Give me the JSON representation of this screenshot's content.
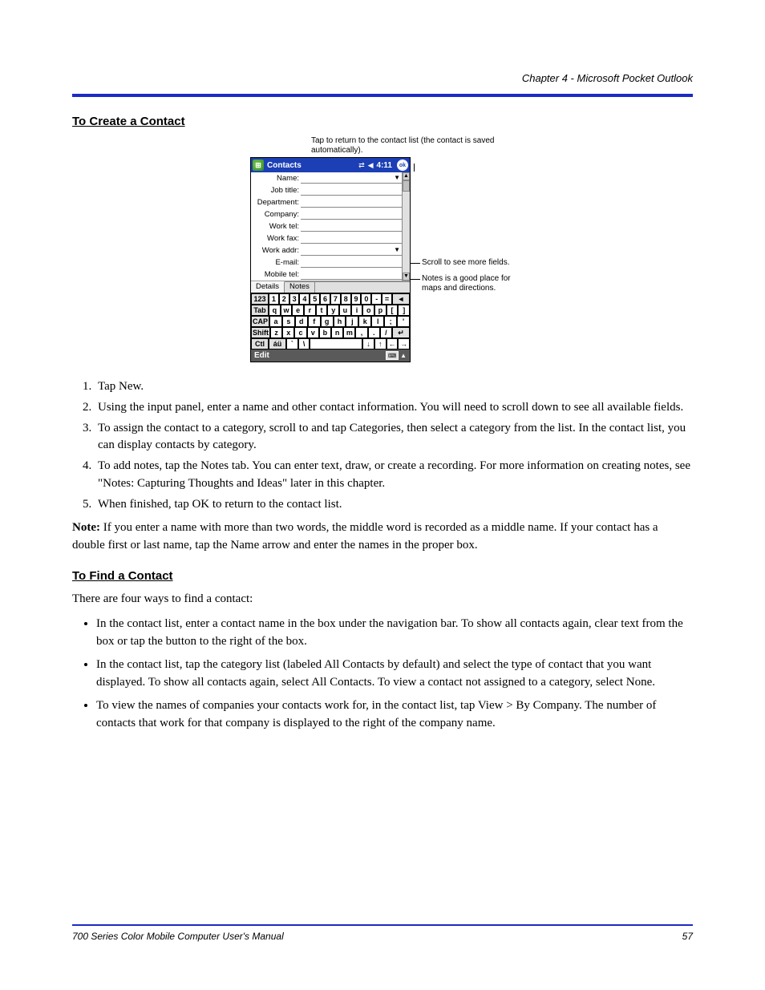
{
  "chapterLine": "Chapter 4 - Microsoft Pocket Outlook",
  "sections": {
    "create": {
      "heading": "To Create a Contact",
      "steps": [
        "Tap New.",
        "Using the input panel, enter a name and other contact information. You will need to scroll down to see all available fields.",
        "To assign the contact to a category, scroll to and tap Categories, then select a category from the list. In the contact list, you can display contacts by category.",
        "To add notes, tap the Notes tab. You can enter text, draw, or create a recording. For more information on creating notes, see \"Notes: Capturing Thoughts and Ideas\" later in this chapter.",
        "When finished, tap OK to return to the contact list."
      ],
      "noteLabel": "Note:",
      "noteText": " If you enter a name with more than two words, the middle word is recorded as a middle name. If your contact has a double first or last name, tap the Name arrow and enter the names in the proper box."
    },
    "find": {
      "heading": "To Find a Contact",
      "intro": "There are four ways to find a contact:",
      "bullets": [
        "In the contact list, enter a contact name in the box under the navigation bar. To show all contacts again, clear text from the box or tap the button to the right of the box.",
        "In the contact list, tap the category list (labeled All Contacts by default) and select the type of contact that you want displayed. To show all contacts again, select All Contacts. To view a contact not assigned to a category, select None.",
        "To view the names of companies your contacts work for, in the contact list, tap View > By Company. The number of contacts that work for that company is displayed to the right of the company name."
      ]
    }
  },
  "callouts": {
    "top": "Tap to return to the contact list (the contact is saved automatically).",
    "scroll": "Scroll to see more fields.",
    "notes": "Notes is a good place for maps and directions."
  },
  "device": {
    "title": "Contacts",
    "time": "4:11",
    "okLabel": "ok",
    "fields": [
      "Name:",
      "Job title:",
      "Department:",
      "Company:",
      "Work tel:",
      "Work fax:",
      "Work addr:",
      "E-mail:",
      "Mobile tel:"
    ],
    "tabs": [
      "Details",
      "Notes"
    ],
    "keyboard": {
      "row1": [
        "123",
        "1",
        "2",
        "3",
        "4",
        "5",
        "6",
        "7",
        "8",
        "9",
        "0",
        "-",
        "=",
        "◄"
      ],
      "row2": [
        "Tab",
        "q",
        "w",
        "e",
        "r",
        "t",
        "y",
        "u",
        "i",
        "o",
        "p",
        "[",
        "]"
      ],
      "row3": [
        "CAP",
        "a",
        "s",
        "d",
        "f",
        "g",
        "h",
        "j",
        "k",
        "l",
        ";",
        "'"
      ],
      "row4": [
        "Shift",
        "z",
        "x",
        "c",
        "v",
        "b",
        "n",
        "m",
        ",",
        ".",
        "/",
        "↵"
      ],
      "row5": [
        "Ctl",
        "áü",
        "`",
        "\\",
        " ",
        "↓",
        "↑",
        "←",
        "→"
      ]
    },
    "editLabel": "Edit"
  },
  "footer": {
    "left": "700 Series Color Mobile Computer User's Manual",
    "right": "57"
  }
}
